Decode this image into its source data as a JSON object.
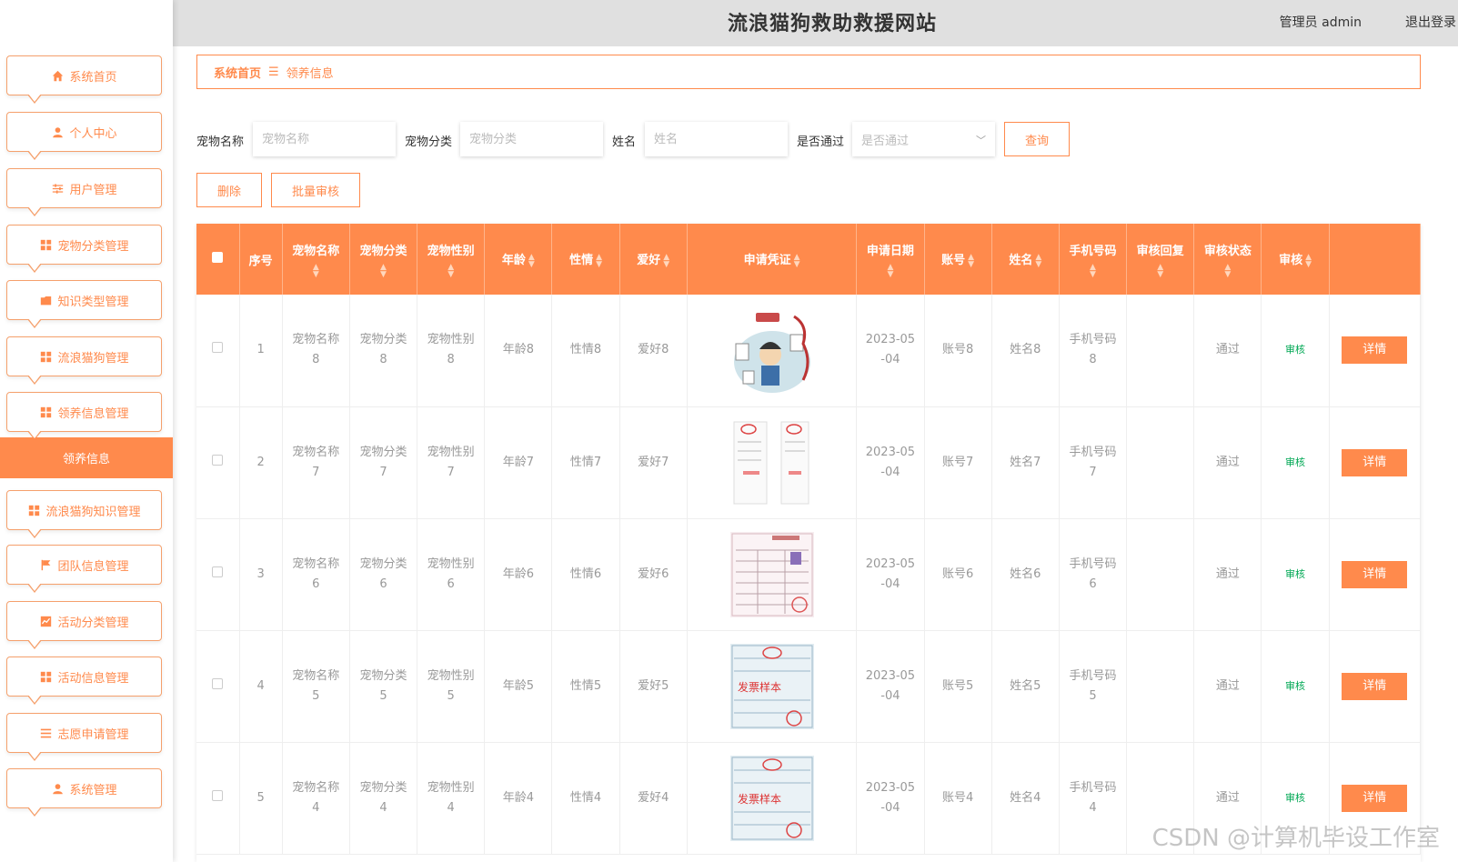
{
  "header": {
    "title": "流浪猫狗救助救援网站",
    "user": "管理员 admin",
    "logout": "退出登录"
  },
  "sidebar": {
    "items": [
      {
        "label": "系统首页",
        "icon": "home-icon"
      },
      {
        "label": "个人中心",
        "icon": "user-icon"
      },
      {
        "label": "用户管理",
        "icon": "sliders-icon"
      },
      {
        "label": "宠物分类管理",
        "icon": "grid-icon"
      },
      {
        "label": "知识类型管理",
        "icon": "folder-icon"
      },
      {
        "label": "流浪猫狗管理",
        "icon": "grid-icon"
      },
      {
        "label": "领养信息管理",
        "icon": "grid-icon"
      },
      {
        "label": "流浪猫狗知识管理",
        "icon": "grid-icon"
      },
      {
        "label": "团队信息管理",
        "icon": "flag-icon"
      },
      {
        "label": "活动分类管理",
        "icon": "chart-icon"
      },
      {
        "label": "活动信息管理",
        "icon": "grid-icon"
      },
      {
        "label": "志愿申请管理",
        "icon": "list-icon"
      },
      {
        "label": "系统管理",
        "icon": "user-icon"
      }
    ],
    "active_sub": "领养信息"
  },
  "breadcrumb": {
    "home": "系统首页",
    "separator": "☰",
    "current": "领养信息"
  },
  "search": {
    "pet_name_label": "宠物名称",
    "pet_name_placeholder": "宠物名称",
    "pet_category_label": "宠物分类",
    "pet_category_placeholder": "宠物分类",
    "name_label": "姓名",
    "name_placeholder": "姓名",
    "passed_label": "是否通过",
    "passed_placeholder": "是否通过",
    "query_button": "查询"
  },
  "actions": {
    "delete": "删除",
    "batch_audit": "批量审核"
  },
  "table": {
    "columns": [
      "序号",
      "宠物名称",
      "宠物分类",
      "宠物性别",
      "年龄",
      "性情",
      "爱好",
      "申请凭证",
      "申请日期",
      "账号",
      "姓名",
      "手机号码",
      "审核回复",
      "审核状态",
      "审核"
    ],
    "rows": [
      {
        "no": "1",
        "pet_name": "宠物名称8",
        "category": "宠物分类8",
        "gender": "宠物性别8",
        "age": "年龄8",
        "temper": "性情8",
        "hobby": "爱好8",
        "date": "2023-05-04",
        "account": "账号8",
        "name": "姓名8",
        "phone": "手机号码8",
        "reply": "",
        "status": "通过",
        "audit": "审核",
        "detail": "详情"
      },
      {
        "no": "2",
        "pet_name": "宠物名称7",
        "category": "宠物分类7",
        "gender": "宠物性别7",
        "age": "年龄7",
        "temper": "性情7",
        "hobby": "爱好7",
        "date": "2023-05-04",
        "account": "账号7",
        "name": "姓名7",
        "phone": "手机号码7",
        "reply": "",
        "status": "通过",
        "audit": "审核",
        "detail": "详情"
      },
      {
        "no": "3",
        "pet_name": "宠物名称6",
        "category": "宠物分类6",
        "gender": "宠物性别6",
        "age": "年龄6",
        "temper": "性情6",
        "hobby": "爱好6",
        "date": "2023-05-04",
        "account": "账号6",
        "name": "姓名6",
        "phone": "手机号码6",
        "reply": "",
        "status": "通过",
        "audit": "审核",
        "detail": "详情"
      },
      {
        "no": "4",
        "pet_name": "宠物名称5",
        "category": "宠物分类5",
        "gender": "宠物性别5",
        "age": "年龄5",
        "temper": "性情5",
        "hobby": "爱好5",
        "date": "2023-05-04",
        "account": "账号5",
        "name": "姓名5",
        "phone": "手机号码5",
        "reply": "",
        "status": "通过",
        "audit": "审核",
        "detail": "详情"
      },
      {
        "no": "5",
        "pet_name": "宠物名称4",
        "category": "宠物分类4",
        "gender": "宠物性别4",
        "age": "年龄4",
        "temper": "性情4",
        "hobby": "爱好4",
        "date": "2023-05-04",
        "account": "账号4",
        "name": "姓名4",
        "phone": "手机号码4",
        "reply": "",
        "status": "通过",
        "audit": "审核",
        "detail": "详情"
      }
    ]
  },
  "watermark": "CSDN @计算机毕设工作室",
  "colors": {
    "accent": "#ff8a4c",
    "success": "#00a854"
  }
}
